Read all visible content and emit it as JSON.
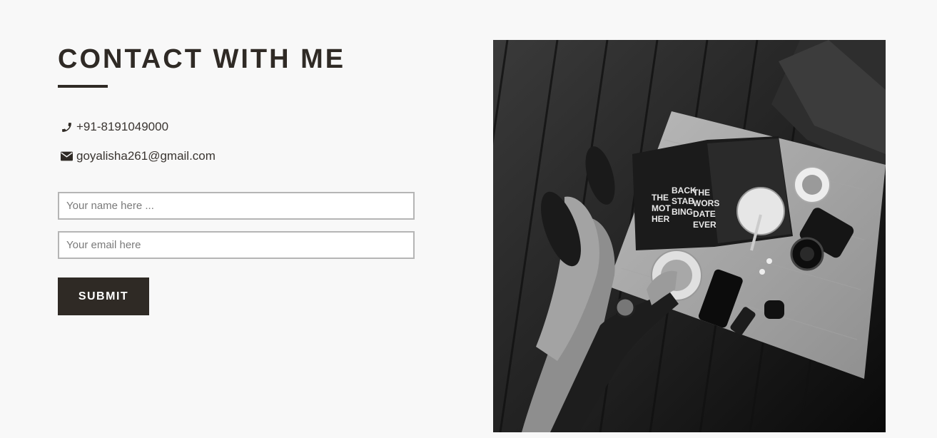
{
  "contact": {
    "title": "CONTACT WITH ME",
    "phone": "+91-8191049000",
    "email": "goyalisha261@gmail.com"
  },
  "form": {
    "name_placeholder": "Your name here ...",
    "email_placeholder": "Your email here",
    "submit_label": "SUBMIT"
  },
  "icons": {
    "phone": "phone-icon",
    "email": "envelope-icon"
  },
  "photo": {
    "magazine_line_1": "THE MOT HER IN-LAW",
    "magazine_line_2": "BACK STAB BING BITCH",
    "magazine_line_3": "THE WORST DATE EVER"
  },
  "colors": {
    "background": "#f8f8f8",
    "text_dark": "#2f2a25",
    "button_bg": "#2f2a25",
    "button_text": "#ffffff",
    "input_border": "#b5b5b5"
  }
}
